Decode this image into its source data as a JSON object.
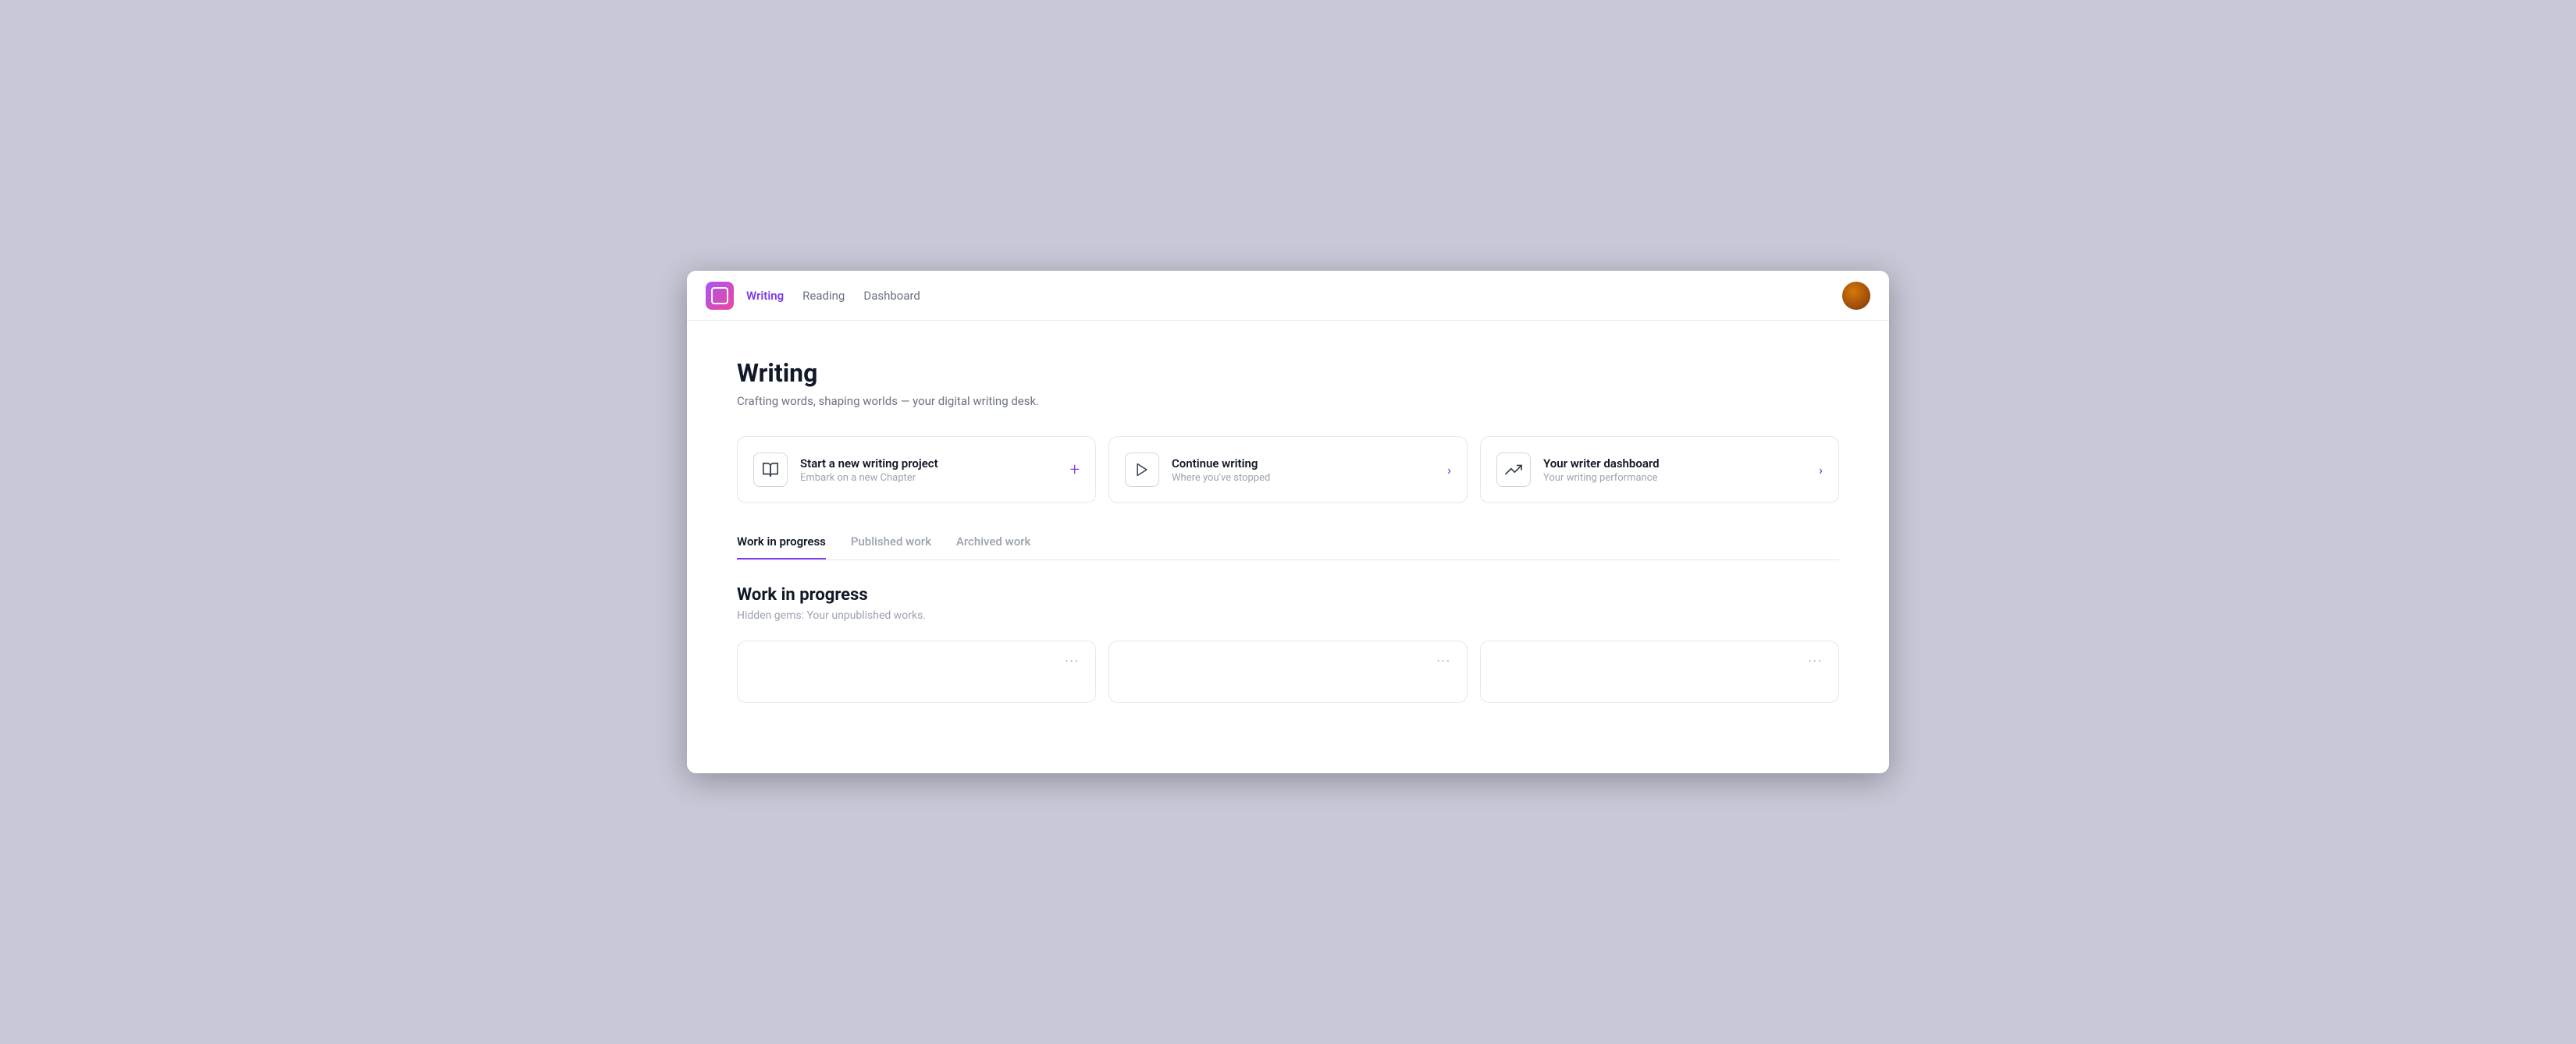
{
  "nav": {
    "links": [
      {
        "label": "Writing",
        "active": true
      },
      {
        "label": "Reading",
        "active": false
      },
      {
        "label": "Dashboard",
        "active": false
      }
    ]
  },
  "page": {
    "title": "Writing",
    "subtitle": "Crafting words, shaping worlds — your digital writing desk."
  },
  "action_cards": [
    {
      "id": "new-project",
      "icon": "book",
      "title": "Start a new writing project",
      "desc": "Embark on a new Chapter",
      "action_type": "plus"
    },
    {
      "id": "continue-writing",
      "icon": "play",
      "title": "Continue writing",
      "desc": "Where you've stopped",
      "action_type": "arrow"
    },
    {
      "id": "writer-dashboard",
      "icon": "trending",
      "title": "Your writer dashboard",
      "desc": "Your writing performance",
      "action_type": "arrow"
    }
  ],
  "tabs": [
    {
      "label": "Work in progress",
      "active": true
    },
    {
      "label": "Published work",
      "active": false
    },
    {
      "label": "Archived work",
      "active": false
    }
  ],
  "work_section": {
    "title": "Work in progress",
    "desc": "Hidden gems: Your unpublished works."
  },
  "work_cards": [
    {
      "menu": "···"
    },
    {
      "menu": "···"
    },
    {
      "menu": "···"
    }
  ]
}
